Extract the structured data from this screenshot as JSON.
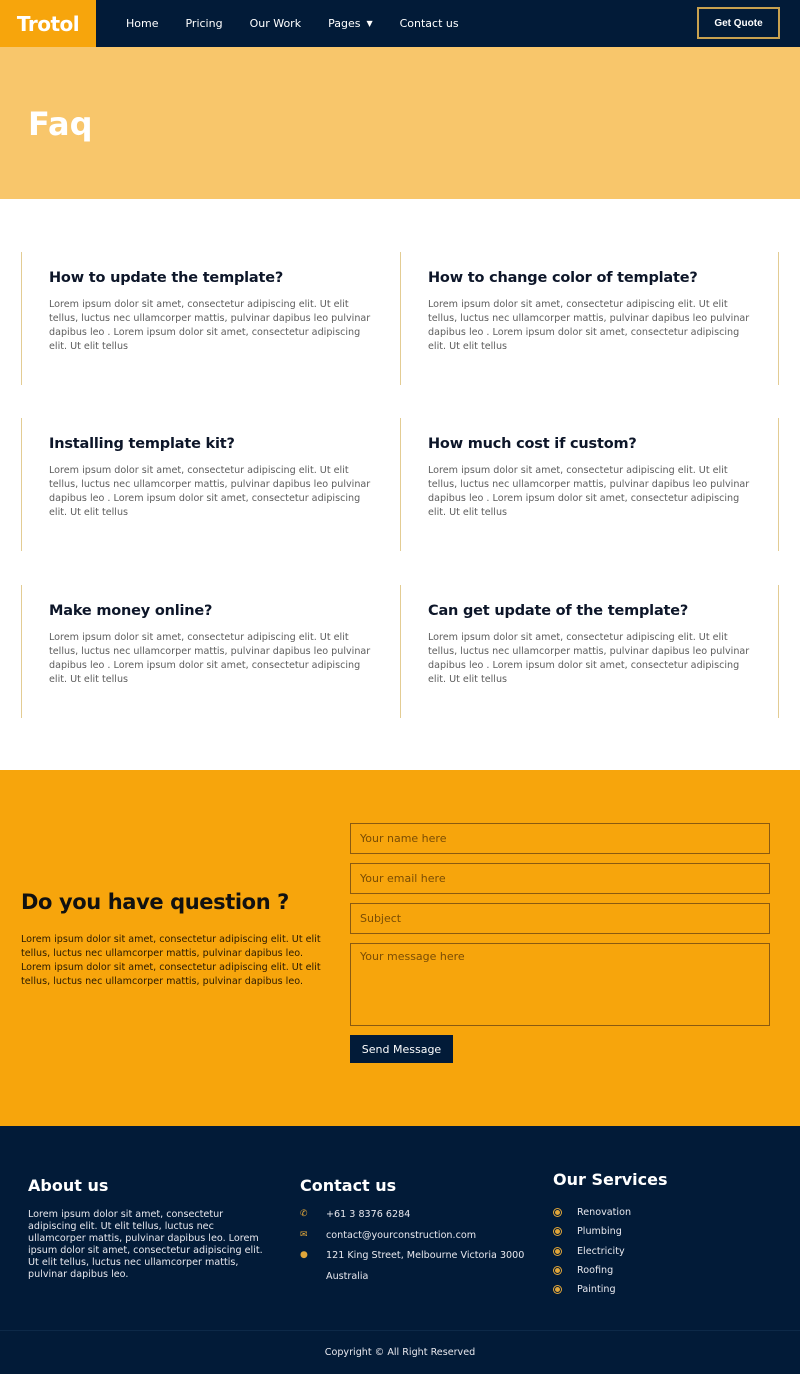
{
  "nav": {
    "logo": "Trotol",
    "items": [
      {
        "label": "Home"
      },
      {
        "label": "Pricing"
      },
      {
        "label": "Our Work"
      },
      {
        "label": "Pages",
        "has_dropdown": true
      },
      {
        "label": "Contact us"
      }
    ],
    "cta": "Get Quote"
  },
  "hero": {
    "title": "Faq"
  },
  "faq": [
    {
      "q": "How to update the template?",
      "a": "Lorem ipsum dolor sit amet, consectetur adipiscing elit. Ut elit tellus, luctus nec ullamcorper mattis, pulvinar dapibus leo pulvinar dapibus leo . Lorem ipsum dolor sit amet, consectetur adipiscing elit. Ut elit tellus"
    },
    {
      "q": "How to change color of template?",
      "a": "Lorem ipsum dolor sit amet, consectetur adipiscing elit. Ut elit tellus, luctus nec ullamcorper mattis, pulvinar dapibus leo pulvinar dapibus leo . Lorem ipsum dolor sit amet, consectetur adipiscing elit. Ut elit tellus"
    },
    {
      "q": "Installing template kit?",
      "a": "Lorem ipsum dolor sit amet, consectetur adipiscing elit. Ut elit tellus, luctus nec ullamcorper mattis, pulvinar dapibus leo pulvinar dapibus leo . Lorem ipsum dolor sit amet, consectetur adipiscing elit. Ut elit tellus"
    },
    {
      "q": "How much cost if custom?",
      "a": "Lorem ipsum dolor sit amet, consectetur adipiscing elit. Ut elit tellus, luctus nec ullamcorper mattis, pulvinar dapibus leo pulvinar dapibus leo . Lorem ipsum dolor sit amet, consectetur adipiscing elit. Ut elit tellus"
    },
    {
      "q": "Make money online?",
      "a": "Lorem ipsum dolor sit amet, consectetur adipiscing elit. Ut elit tellus, luctus nec ullamcorper mattis, pulvinar dapibus leo pulvinar dapibus leo . Lorem ipsum dolor sit amet, consectetur adipiscing elit. Ut elit tellus"
    },
    {
      "q": "Can get update of the template?",
      "a": "Lorem ipsum dolor sit amet, consectetur adipiscing elit. Ut elit tellus, luctus nec ullamcorper mattis, pulvinar dapibus leo pulvinar dapibus leo . Lorem ipsum dolor sit amet, consectetur adipiscing elit. Ut elit tellus"
    }
  ],
  "contact": {
    "title": "Do you have question ?",
    "desc": "Lorem ipsum dolor sit amet, consectetur adipiscing elit. Ut elit tellus, luctus nec ullamcorper mattis, pulvinar dapibus leo. Lorem ipsum dolor sit amet, consectetur adipiscing elit. Ut elit tellus, luctus nec ullamcorper mattis, pulvinar dapibus leo.",
    "form": {
      "name_placeholder": "Your name here",
      "email_placeholder": "Your email here",
      "subject_placeholder": "Subject",
      "message_placeholder": "Your message here",
      "submit": "Send Message"
    }
  },
  "footer": {
    "about": {
      "title": "About us",
      "text": "Lorem ipsum dolor sit amet, consectetur adipiscing elit. Ut elit tellus, luctus nec ullamcorper mattis, pulvinar dapibus leo. Lorem ipsum dolor sit amet, consectetur adipiscing elit. Ut elit tellus, luctus nec ullamcorper mattis, pulvinar dapibus leo."
    },
    "contact": {
      "title": "Contact us",
      "phone": "+61 3 8376 6284",
      "email": "contact@yourconstruction.com",
      "address_line1": "121 King Street, Melbourne Victoria 3000",
      "address_line2": "Australia"
    },
    "services": {
      "title": "Our Services",
      "items": [
        "Renovation",
        "Plumbing",
        "Electricity",
        "Roofing",
        "Painting"
      ]
    },
    "copyright": "Copyright © All Right Reserved"
  },
  "colors": {
    "accent": "#f7a50c",
    "navy": "#021b38",
    "hero_bg": "#f8c66b",
    "card_border": "#e3cc93"
  }
}
